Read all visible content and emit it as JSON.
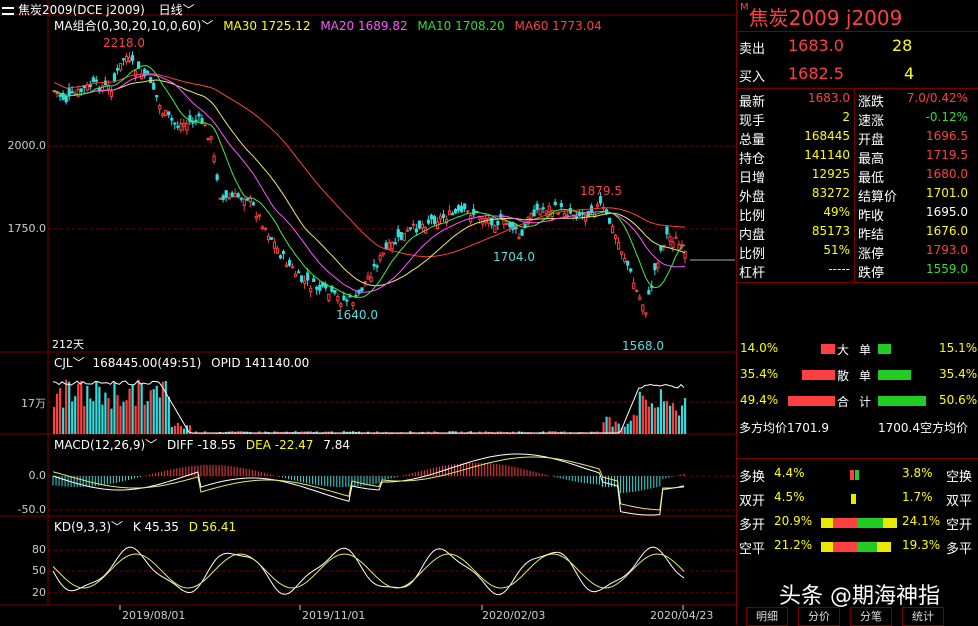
{
  "titlebar": {
    "title": "焦炭2009(DCE j2009)",
    "period": "日线"
  },
  "ma": {
    "label": "MA组合(0,30,20,10,0,60)",
    "ma30": "MA30 1725.12",
    "ma20": "MA20 1689.82",
    "ma10": "MA10 1708.20",
    "ma60": "MA60 1773.04"
  },
  "price_axis": {
    "y2000": "2000.0",
    "y1750": "1750.0"
  },
  "annotations": {
    "high": "2218.0",
    "low1": "1640.0",
    "mid": "1704.0",
    "peak": "1879.5",
    "low2": "1568.0",
    "days": "212天"
  },
  "vol": {
    "label": "CJL",
    "values": "168445.00(49:51)",
    "opid": "OPID 141140.00",
    "axis": "17万"
  },
  "macd": {
    "label": "MACD(12,26,9)",
    "diff": "DIFF -18.55",
    "dea": "DEA -22.47",
    "val": "7.84",
    "y0": "0.0",
    "yneg": "-50.0"
  },
  "kd": {
    "label": "KD(9,3,3)",
    "k": "K 45.35",
    "d": "D 56.41",
    "y80": "80",
    "y50": "50",
    "y20": "20"
  },
  "xaxis": [
    "2019/08/01",
    "2019/11/01",
    "2020/02/03",
    "2020/04/23"
  ],
  "quote": {
    "title": "焦炭2009  j2009",
    "sell_label": "卖出",
    "sell_price": "1683.0",
    "sell_vol": "28",
    "buy_label": "买入",
    "buy_price": "1682.5",
    "buy_vol": "4",
    "rows": [
      {
        "l1": "最新",
        "v1": "1683.0",
        "l2": "涨跌",
        "v2": "7.0/0.42%"
      },
      {
        "l1": "现手",
        "v1": "2",
        "l2": "速涨",
        "v2": "-0.12%"
      },
      {
        "l1": "总量",
        "v1": "168445",
        "l2": "开盘",
        "v2": "1696.5"
      },
      {
        "l1": "持仓",
        "v1": "141140",
        "l2": "最高",
        "v2": "1719.5"
      },
      {
        "l1": "日增",
        "v1": "12925",
        "l2": "最低",
        "v2": "1680.0"
      },
      {
        "l1": "外盘",
        "v1": "83272",
        "l2": "结算价",
        "v2": "1701.0"
      },
      {
        "l1": "比例",
        "v1": "49%",
        "l2": "昨收",
        "v2": "1695.0"
      },
      {
        "l1": "内盘",
        "v1": "85173",
        "l2": "昨结",
        "v2": "1676.0"
      },
      {
        "l1": "比例",
        "v1": "51%",
        "l2": "涨停",
        "v2": "1793.0"
      },
      {
        "l1": "杠杆",
        "v1": "-----",
        "l2": "跌停",
        "v2": "1559.0"
      }
    ],
    "big": {
      "left": "14.0%",
      "label1": "大",
      "label2": "单",
      "right": "15.1%"
    },
    "retail": {
      "left": "35.4%",
      "label1": "散",
      "label2": "单",
      "right": "35.4%"
    },
    "total": {
      "left": "49.4%",
      "label1": "合",
      "label2": "计",
      "right": "50.6%"
    },
    "avg": {
      "left": "多方均价1701.9",
      "right": "1700.4空方均价"
    },
    "flow": [
      {
        "l": "多换",
        "lv": "4.4%",
        "rv": "3.8%",
        "r": "空换"
      },
      {
        "l": "双开",
        "lv": "4.5%",
        "rv": "1.7%",
        "r": "双平"
      },
      {
        "l": "多开",
        "lv": "20.9%",
        "rv": "24.1%",
        "r": "空开"
      },
      {
        "l": "空平",
        "lv": "21.2%",
        "rv": "19.3%",
        "r": "多平"
      }
    ]
  },
  "tabs": [
    "明细",
    "分价",
    "分笔",
    "统计"
  ],
  "watermark": "头条 @期海神指",
  "colors": {
    "up": "#ff4040",
    "down": "#33dddd",
    "ma30": "#e8e870",
    "ma20": "#ff55ff",
    "ma10": "#44ee44",
    "ma60": "#ff4040",
    "grid": "#7a0000"
  }
}
